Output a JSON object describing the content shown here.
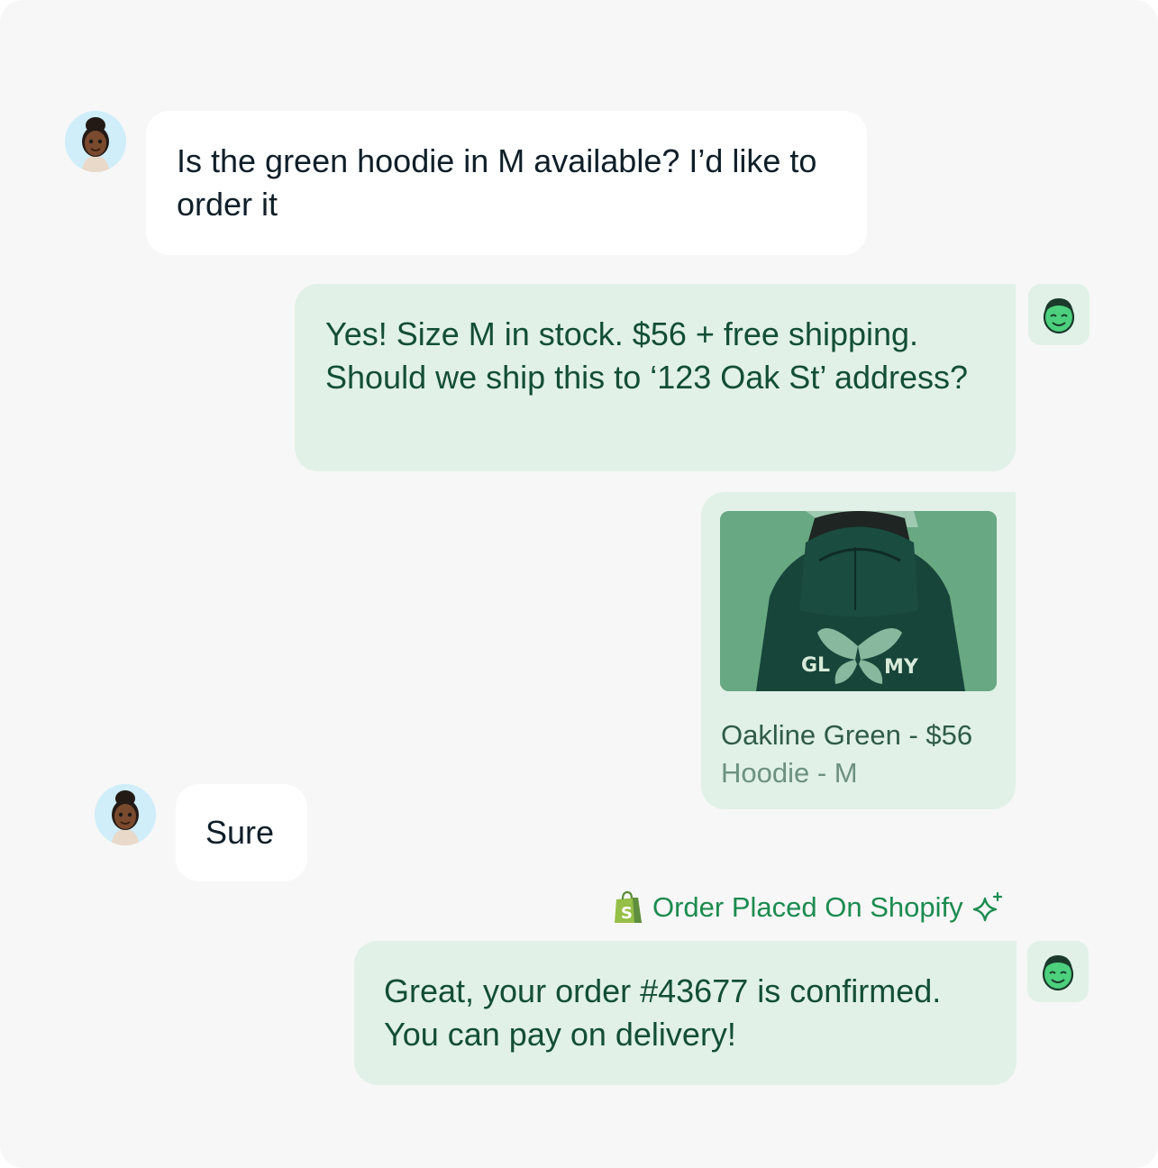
{
  "messages": [
    {
      "sender": "customer",
      "text": "Is the green hoodie in M available? I’d like to order it"
    },
    {
      "sender": "bot",
      "text": "Yes! Size M in stock. $56 + free shipping. Should we ship this to ‘123 Oak St’ address?"
    },
    {
      "sender": "customer",
      "text": "Sure"
    },
    {
      "sender": "bot",
      "text": "Great, your order #43677 is confirmed. You can pay on delivery!"
    }
  ],
  "product_card": {
    "title": "Oakline Green - $56",
    "subtitle": "Hoodie - M",
    "print_text": "GLOOMY"
  },
  "shopify_note": {
    "text": "Order Placed On Shopify",
    "icons": [
      "shopify-bag-icon",
      "sparkle-icon"
    ]
  },
  "colors": {
    "background": "#f7f7f7",
    "user_bubble": "#ffffff",
    "bot_bubble": "#e1f1e7",
    "bot_text": "#134e36",
    "accent_green": "#1c8b4f"
  }
}
